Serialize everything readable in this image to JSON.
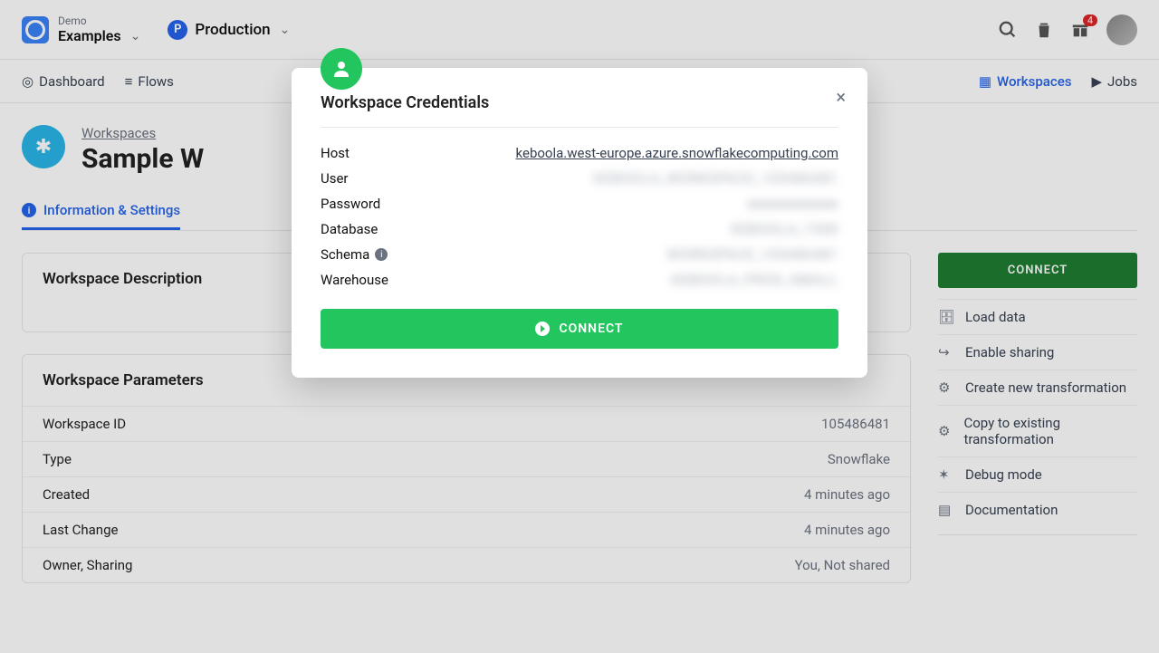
{
  "top": {
    "project_label": "Demo",
    "project_name": "Examples",
    "env_badge": "P",
    "env_name": "Production",
    "notif_count": "4"
  },
  "nav": {
    "dashboard": "Dashboard",
    "flows": "Flows",
    "workspaces": "Workspaces",
    "jobs": "Jobs"
  },
  "breadcrumb": "Workspaces",
  "page_title": "Sample W",
  "tab_info": "Information & Settings",
  "card_desc_title": "Workspace Description",
  "card_params_title": "Workspace Parameters",
  "params": {
    "id_label": "Workspace ID",
    "id_val": "105486481",
    "type_label": "Type",
    "type_val": "Snowflake",
    "created_label": "Created",
    "created_val": "4 minutes ago",
    "change_label": "Last Change",
    "change_val": "4 minutes ago",
    "owner_label": "Owner, Sharing",
    "owner_val": "You, Not shared"
  },
  "side": {
    "connect": "CONNECT",
    "load": "Load data",
    "share": "Enable sharing",
    "create": "Create new transformation",
    "copy": "Copy to existing transformation",
    "debug": "Debug mode",
    "docs": "Documentation"
  },
  "modal": {
    "title": "Workspace Credentials",
    "host_label": "Host",
    "host_val": "keboola.west-europe.azure.snowflakecomputing.com",
    "user_label": "User",
    "user_val": "KEBOOLA_WORKSPACE_105486481",
    "pass_label": "Password",
    "pass_val": "●●●●●●●●●●",
    "db_label": "Database",
    "db_val": "KEBOOLA_7368",
    "schema_label": "Schema",
    "schema_val": "WORKSPACE_105486481",
    "wh_label": "Warehouse",
    "wh_val": "KEBOOLA_PROD_SMALL",
    "connect": "CONNECT"
  }
}
